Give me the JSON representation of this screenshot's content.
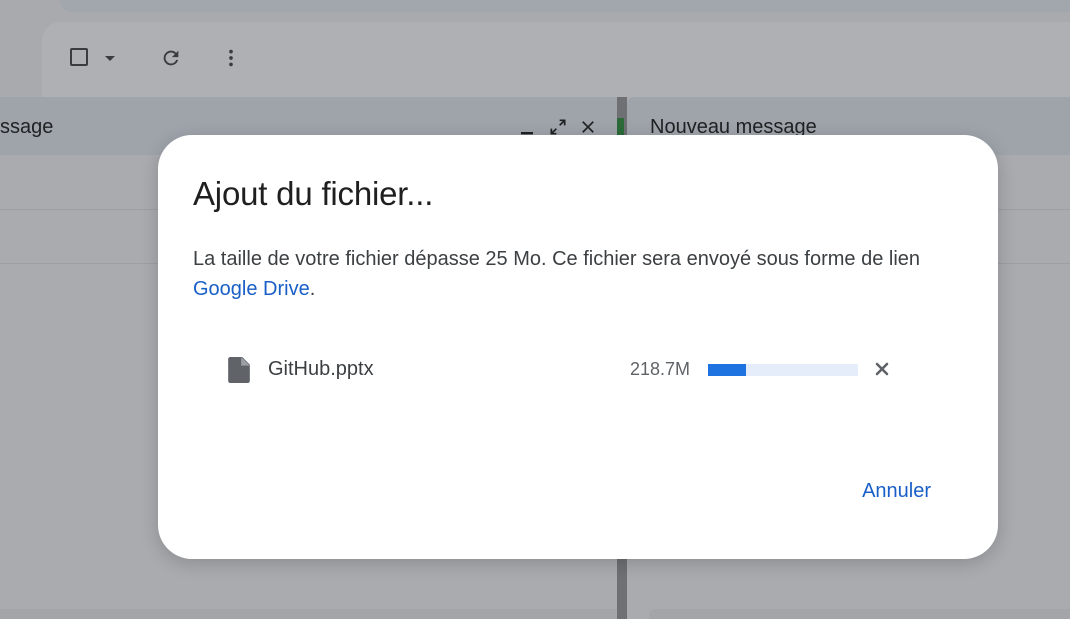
{
  "background": {
    "left_compose_title": "ssage",
    "right_compose_title": "Nouveau message",
    "icons": {
      "select_checkbox": "checkbox-outline-icon",
      "select_dropdown": "caret-down-icon",
      "refresh": "refresh-icon",
      "more": "more-vert-icon",
      "minimize": "minimize-icon",
      "expand": "expand-icon",
      "close": "close-icon"
    }
  },
  "dialog": {
    "title": "Ajout du fichier...",
    "message_text": "La taille de votre fichier dépasse 25 Mo. Ce fichier sera envoyé sous forme de lien ",
    "message_link": "Google Drive",
    "message_end": ".",
    "file": {
      "icon": "file-icon",
      "name": "GitHub.pptx",
      "size": "218.7M",
      "progress_percent": 25,
      "cancel_icon": "close-icon"
    },
    "cancel_label": "Annuler"
  },
  "colors": {
    "accent": "#1a5fc7",
    "progress_fill": "#1f73e0",
    "progress_track": "#e5edfa"
  }
}
